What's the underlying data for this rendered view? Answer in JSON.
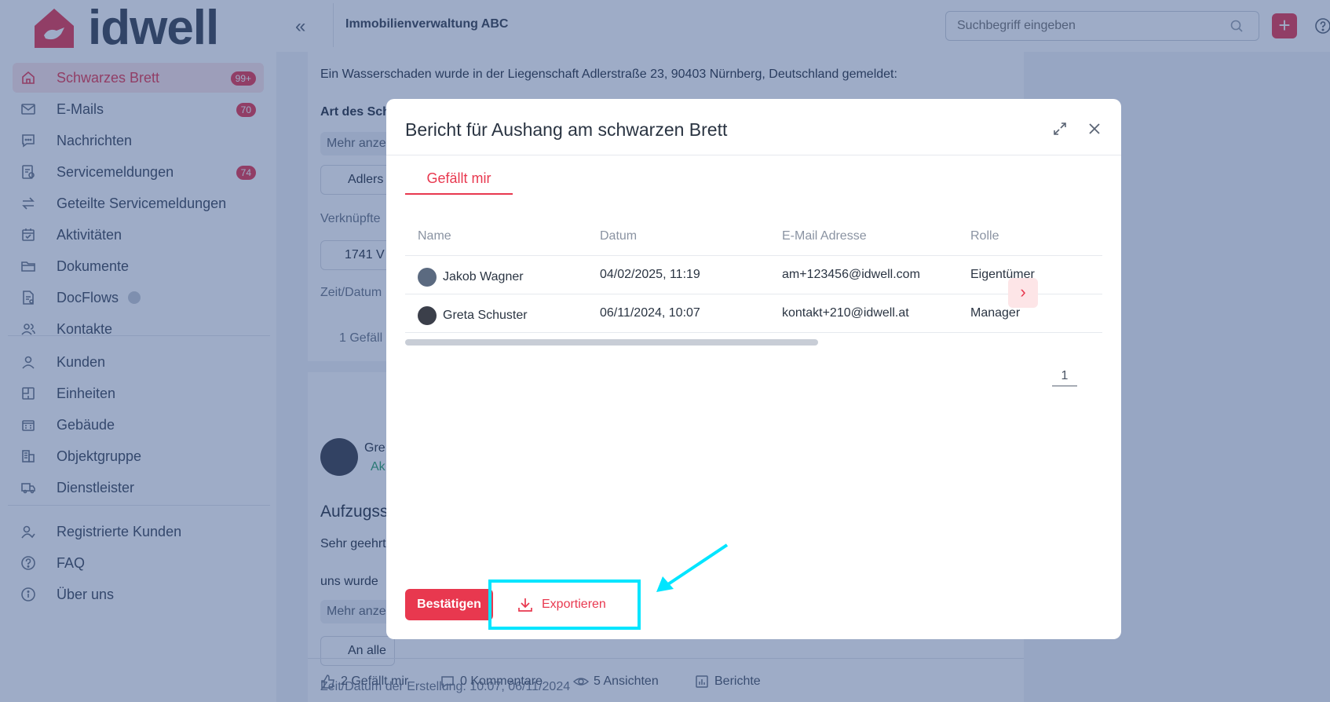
{
  "brand": {
    "name": "idwell"
  },
  "sidebar": {
    "items": [
      {
        "label": "Schwarzes Brett",
        "badge": "99+",
        "icon": "home-icon",
        "active": true
      },
      {
        "label": "E-Mails",
        "badge": "70",
        "icon": "mail-icon"
      },
      {
        "label": "Nachrichten",
        "badge": "",
        "icon": "chat-icon"
      },
      {
        "label": "Servicemeldungen",
        "badge": "74",
        "icon": "service-icon"
      },
      {
        "label": "Geteilte Servicemeldungen",
        "badge": "",
        "icon": "swap-icon"
      },
      {
        "label": "Aktivitäten",
        "badge": "",
        "icon": "calendar-icon"
      },
      {
        "label": "Dokumente",
        "badge": "",
        "icon": "folder-icon"
      },
      {
        "label": "DocFlows",
        "badge": "",
        "icon": "docflow-icon"
      },
      {
        "label": "Kontakte",
        "badge": "",
        "icon": "contacts-icon"
      }
    ],
    "items2": [
      {
        "label": "Kunden",
        "icon": "user-icon"
      },
      {
        "label": "Einheiten",
        "icon": "unit-icon"
      },
      {
        "label": "Gebäude",
        "icon": "building-icon"
      },
      {
        "label": "Objektgruppe",
        "icon": "group-icon"
      },
      {
        "label": "Dienstleister",
        "icon": "truck-icon"
      }
    ],
    "items3": [
      {
        "label": "Registrierte Kunden",
        "icon": "registered-user-icon"
      },
      {
        "label": "FAQ",
        "icon": "question-icon"
      },
      {
        "label": "Über uns",
        "icon": "info-icon"
      }
    ]
  },
  "topbar": {
    "org": "Immobilienverwaltung ABC",
    "search_placeholder": "Suchbegriff eingeben"
  },
  "feed": {
    "intro": "Ein Wasserschaden wurde in der Liegenschaft Adlerstraße 23, 90403 Nürnberg, Deutschland gemeldet:",
    "type_label": "Art des Sch",
    "more1": "Mehr anze",
    "property_chip": "Adlers",
    "linked_label": "Verknüpfte",
    "ticket_chip": "1741 V",
    "time_label": "Zeit/Datum",
    "likes1": "1 Gefäll",
    "author_short": "Gre",
    "status_short": "Ak",
    "post_title": "Aufzugss",
    "greeting": "Sehr geehrt",
    "body": "uns wurde",
    "more2": "Mehr anze",
    "audience_chip": "An alle",
    "created_label": "Zeit/Datum der Erstellung: 10:07, 06/11/2024",
    "footer": {
      "likes": "2 Gefällt mir",
      "comments": "0 Kommentare",
      "views": "5 Ansichten",
      "reports": "Berichte"
    }
  },
  "modal": {
    "title": "Bericht für Aushang am schwarzen Brett",
    "tab": "Gefällt mir",
    "columns": [
      "Name",
      "Datum",
      "E-Mail Adresse",
      "Rolle"
    ],
    "rows": [
      {
        "name": "Jakob Wagner",
        "date": "04/02/2025, 11:19",
        "email": "am+123456@idwell.com",
        "role": "Eigentümer"
      },
      {
        "name": "Greta Schuster",
        "date": "06/11/2024, 10:07",
        "email": "kontakt+210@idwell.at",
        "role": "Manager"
      }
    ],
    "page": "1",
    "confirm": "Bestätigen",
    "export": "Exportieren"
  },
  "colors": {
    "accent": "#e8384f",
    "highlight": "#00e5ff",
    "overlay": "#284882"
  }
}
